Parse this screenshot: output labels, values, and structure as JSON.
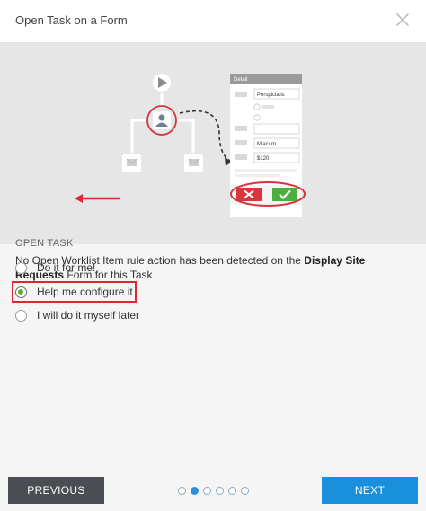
{
  "dialog": {
    "title": "Open Task on a Form"
  },
  "illustration": {
    "form_header": "Detail",
    "fields": [
      "Perspiciatis",
      "Mlacum",
      "$120"
    ]
  },
  "info": {
    "heading": "OPEN TASK",
    "description_pre": "No Open Worklist Item rule action has been detected on the ",
    "form_name": "Display Site Requests",
    "description_post": " Form for this Task"
  },
  "options": [
    {
      "label": "Do it for me!",
      "checked": false
    },
    {
      "label": "Help me configure it",
      "checked": true
    },
    {
      "label": "I will do it myself later",
      "checked": false
    }
  ],
  "footer": {
    "previous_label": "PREVIOUS",
    "next_label": "NEXT",
    "page_count": 6,
    "current_page": 2
  },
  "colors": {
    "accent": "#1a8fdc",
    "highlight": "#e0262f",
    "radio_selected": "#5cb030"
  }
}
